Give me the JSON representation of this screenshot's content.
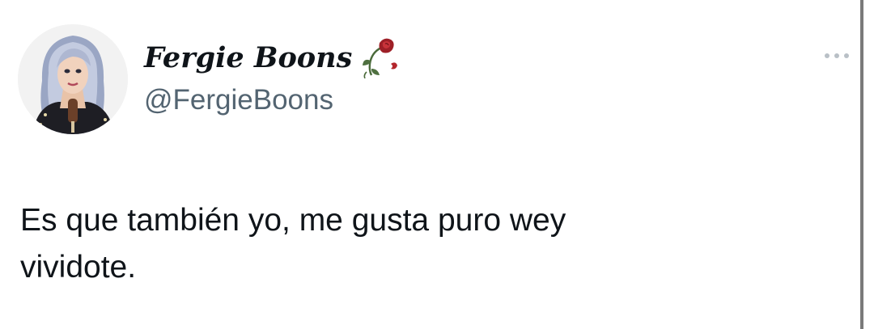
{
  "tweet": {
    "display_name": "Fergie Boons",
    "handle": "@FergieBoons",
    "text": "Es que también yo, me gusta puro wey\nvividote."
  },
  "icons": {
    "name_badge": "wilted-rose-icon",
    "more": "more-options-icon"
  },
  "colors": {
    "text_primary": "#0f1419",
    "text_secondary": "#536471",
    "rose": "#b3262c"
  }
}
